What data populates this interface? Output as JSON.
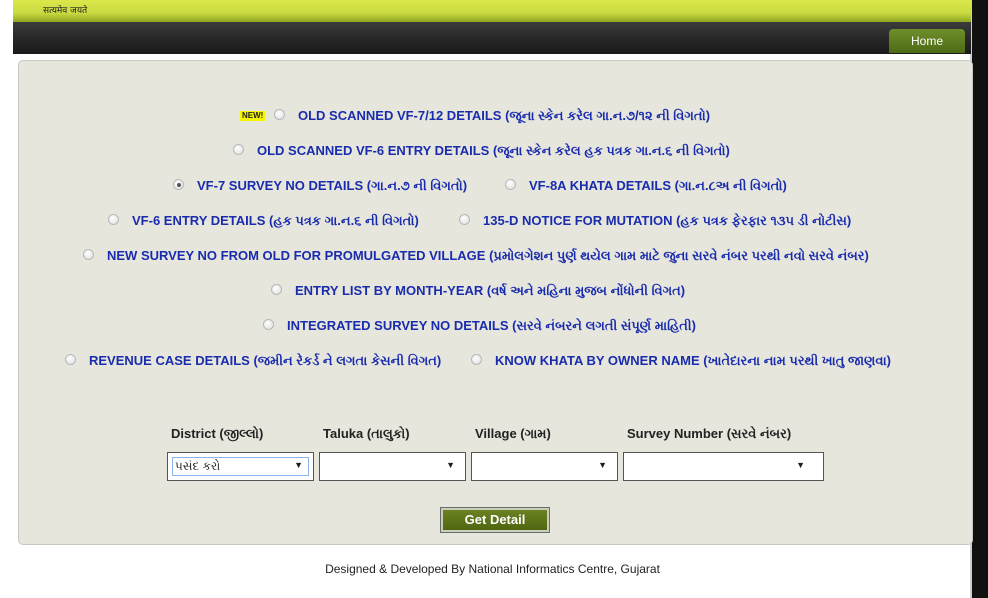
{
  "header": {
    "motto": "सत्यमेव जयते",
    "home_label": "Home"
  },
  "badges": {
    "new": "NEW!"
  },
  "options": {
    "o1": {
      "en": "OLD SCANNED VF-7/12 DETAILS",
      "gu": "(જૂના સ્કેન કરેલ ગા.ન.૭/૧૨ ની વિગતો)"
    },
    "o2": {
      "en": "OLD SCANNED VF-6 ENTRY DETAILS",
      "gu": "(જૂના સ્કેન કરેલ હક પત્રક ગા.ન.૬ ની વિગતો)"
    },
    "o3": {
      "en": "VF-7 SURVEY NO DETAILS",
      "gu": "(ગા.ન.૭ ની વિગતો)"
    },
    "o4": {
      "en": "VF-8A KHATA DETAILS",
      "gu": "(ગા.ન.૮અ ની વિગતો)"
    },
    "o5": {
      "en": "VF-6 ENTRY DETAILS",
      "gu": "(હક પત્રક ગા.ન.૬ ની વિગતો)"
    },
    "o6": {
      "en": "135-D NOTICE FOR MUTATION",
      "gu": "(હક પત્રક ફેરફાર ૧૩૫ ડી નોટીસ)"
    },
    "o7": {
      "en": "NEW SURVEY NO FROM OLD FOR PROMULGATED VILLAGE",
      "gu": "(પ્રમોલગેશન પુર્ણ થયેલ ગામ માટે જુના સરવે નંબર પરથી નવો સરવે નંબર)"
    },
    "o8": {
      "en": "ENTRY LIST BY MONTH-YEAR",
      "gu": "(વર્ષ અને મહિના મુજબ નોંધોની વિગત)"
    },
    "o9": {
      "en": "INTEGRATED SURVEY NO DETAILS",
      "gu": "(સરવે નંબરને લગતી સંપૂર્ણ માહિતી)"
    },
    "o10": {
      "en": "REVENUE CASE DETAILS",
      "gu": "(જમીન રેકર્ડ ને લગતા કેસની વિગત)"
    },
    "o11": {
      "en": "KNOW KHATA BY OWNER NAME",
      "gu": "(ખાતેદારના નામ પરથી ખાતુ જાણવા)"
    }
  },
  "form": {
    "district_label": "District (જીલ્લો)",
    "taluka_label": "Taluka (તાલુકો)",
    "village_label": "Village (ગામ)",
    "survey_label": "Survey Number (સરવે નંબર)",
    "district_value": "પસંદ કરો",
    "taluka_value": "",
    "village_value": "",
    "survey_value": "",
    "submit_label": "Get Detail"
  },
  "footer": {
    "credit": "Designed & Developed By National Informatics Centre, Gujarat"
  },
  "colors": {
    "option_text": "#1a2cae",
    "panel_bg": "#e6e6dd",
    "button_green": "#5a7418",
    "header_green": "#c8d940"
  },
  "selected_option": "VF-7 SURVEY NO DETAILS"
}
